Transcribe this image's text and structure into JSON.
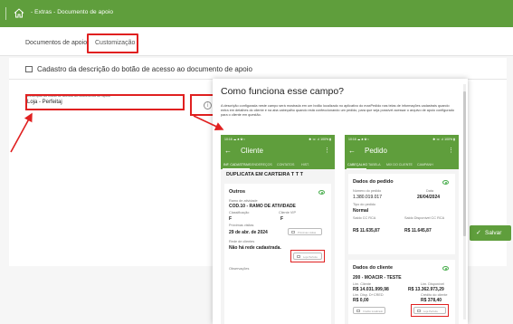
{
  "breadcrumb": {
    "text": "- Extras - Documento de apoio"
  },
  "tabs": {
    "documentos": "Documentos de apoio",
    "customizacao": "Customização"
  },
  "card": {
    "title": "Cadastro da descrição do botão de acesso ao documento de apoio",
    "field_label": "Descrição do botão de acesso ao documento de apoio *",
    "field_value": "Loja - Perfeitaj",
    "info_icon": "i"
  },
  "save_button": {
    "icon": "✓",
    "label": "Salvar"
  },
  "modal": {
    "title": "Como funciona esse campo?",
    "description": "A descrição configurada neste campo será mostrada em um botão localizado no aplicativo do maxPedido nas telas de informações cadastrais quando entra em detalhes do cliente e na aba cabeçalho quando está confeccionando um pedido, para que seja possível acessar o arquivo de apoio configurado para o cliente em questão."
  },
  "phone_left": {
    "status_time": "10:16 ☁ ♣ ✿ •",
    "status_right": "✱ ☏ .ıl 100% ▮",
    "title": "Cliente",
    "tabs": [
      "INF. CADASTRAIS",
      "ENDEREÇOS",
      "CONTATOS",
      "HIST."
    ],
    "dup": "DUPLICATA EM CARTEIRA T T T",
    "section": "Outros",
    "ramo_label": "Ramo de atividade",
    "ramo_value": "COD.10 - RAMO DE ATIVIDADE",
    "class_label": "Classificação",
    "class_value": "F",
    "vip_label": "Cliente VIP",
    "vip_value": "F",
    "prox_label": "Próximas visitas",
    "prox_value": "29 de abr. de 2024",
    "prox_button": "Próximas visitas",
    "rede_label": "Rede de clientes",
    "rede_value": "Não há rede cadastrada.",
    "loja_button": "Loja Perfeita",
    "obs_label": "Observações"
  },
  "phone_right": {
    "status_time": "10:16 ☁ ♣ ✿ •",
    "status_right": "✱ ☏ .ıl 100% ▮",
    "title": "Pedido",
    "tabs": [
      "CABEÇALHO",
      "TABELA",
      "MIX DO CLIENTE",
      "CAMPANH"
    ],
    "dados_pedido": "Dados do pedido",
    "num_label": "Número do pedido",
    "num_value": "1.380.019.017",
    "data_label": "Data",
    "data_value": "26/04/2024",
    "tipo_label": "Tipo do pedido",
    "tipo_value": "Normal",
    "saldo_rca_label": "Saldo CC RCA",
    "saldo_rca_value": "R$ 11.635,87",
    "saldo_disp_label": "Saldo Disponível CC RCA",
    "saldo_disp_value": "R$ 11.645,87",
    "dados_cliente": "Dados do cliente",
    "cliente_value": "200 - MOACIR - TESTE",
    "lim_label": "Lim. Cliente",
    "lim_value": "R$ 14.031.999,98",
    "lim_disp_label": "Lim. Disponível",
    "lim_disp_value": "R$ 13.362.973,29",
    "credi_label": "Lim. Disp. D+CRED",
    "credi_value": "R$ 0,00",
    "cred_cli_label": "Crédito do cliente",
    "cred_cli_value": "R$ 378,40",
    "credito_button": "Crédito localizado",
    "loja_button": "Loja Perfeita"
  }
}
